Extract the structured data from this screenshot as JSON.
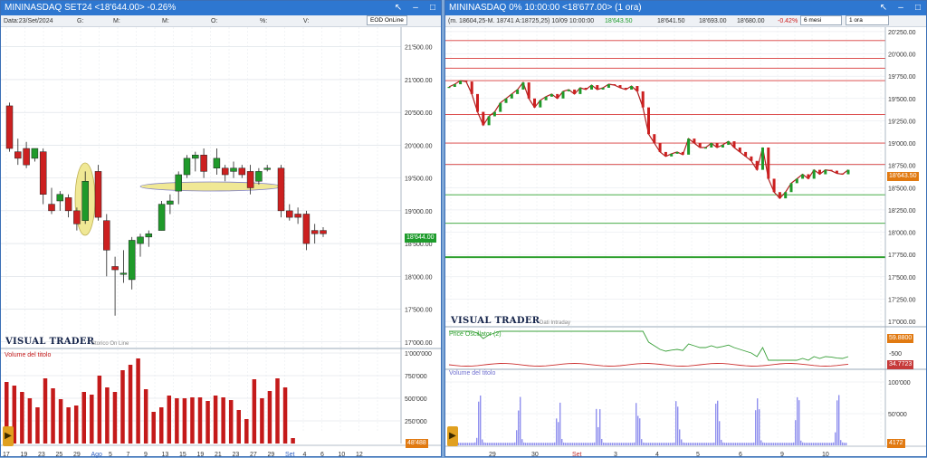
{
  "left": {
    "title": "MININASDAQ SET24 <18'644.00> -0.26%",
    "info": {
      "date": "Data:23/Set/2024",
      "g": "G:",
      "m": "M:",
      "o": "O:",
      "pct": "%:",
      "v": "V:"
    },
    "source_chip": "EOD OnLine",
    "price_tag": "18'644.00",
    "logo": "VISUAL TRADER",
    "logo_sub": "Storico On Line",
    "volume_label": "Volume del titolo",
    "volume_tag": "48'488",
    "y_labels": [
      "21'500.00",
      "21'000.00",
      "20'500.00",
      "20'000.00",
      "19'500.00",
      "19'000.00",
      "18'500.00",
      "18'000.00",
      "17'500.00",
      "17'000.00"
    ],
    "vol_labels": [
      "1'000'000",
      "750'000",
      "500'000",
      "250'000"
    ],
    "x_labels": [
      "17",
      "19",
      "23",
      "25",
      "29",
      "Ago",
      "5",
      "7",
      "9",
      "13",
      "15",
      "19",
      "21",
      "23",
      "27",
      "29",
      "Set",
      "4",
      "6",
      "10",
      "12"
    ],
    "colors": {
      "up": "#1f9a2a",
      "down": "#cc2020",
      "volume": "#c41a1a",
      "highlight": "#efe68a"
    },
    "candles": [
      {
        "o": 20600,
        "h": 20650,
        "l": 19900,
        "c": 19950
      },
      {
        "o": 19900,
        "h": 20100,
        "l": 19700,
        "c": 19800
      },
      {
        "o": 19950,
        "h": 20050,
        "l": 19650,
        "c": 19700
      },
      {
        "o": 19800,
        "h": 19950,
        "l": 19750,
        "c": 19950
      },
      {
        "o": 19900,
        "h": 19950,
        "l": 19100,
        "c": 19250
      },
      {
        "o": 19100,
        "h": 19350,
        "l": 18950,
        "c": 19000
      },
      {
        "o": 19150,
        "h": 19300,
        "l": 19000,
        "c": 19250
      },
      {
        "o": 19200,
        "h": 19250,
        "l": 18900,
        "c": 19000
      },
      {
        "o": 19000,
        "h": 19050,
        "l": 18700,
        "c": 18800
      },
      {
        "o": 18850,
        "h": 19600,
        "l": 18800,
        "c": 19450
      },
      {
        "o": 19600,
        "h": 19700,
        "l": 18850,
        "c": 18900
      },
      {
        "o": 18850,
        "h": 18950,
        "l": 18000,
        "c": 18400
      },
      {
        "o": 18150,
        "h": 18300,
        "l": 17400,
        "c": 18100
      },
      {
        "o": 18050,
        "h": 18400,
        "l": 17900,
        "c": 18050
      },
      {
        "o": 17950,
        "h": 18600,
        "l": 17800,
        "c": 18550
      },
      {
        "o": 18500,
        "h": 18650,
        "l": 18300,
        "c": 18600
      },
      {
        "o": 18600,
        "h": 18700,
        "l": 18450,
        "c": 18650
      },
      {
        "o": 18700,
        "h": 19150,
        "l": 18700,
        "c": 19100
      },
      {
        "o": 19100,
        "h": 19250,
        "l": 18950,
        "c": 19150
      },
      {
        "o": 19300,
        "h": 19600,
        "l": 19100,
        "c": 19550
      },
      {
        "o": 19550,
        "h": 19850,
        "l": 19500,
        "c": 19800
      },
      {
        "o": 19800,
        "h": 19900,
        "l": 19600,
        "c": 19850
      },
      {
        "o": 19850,
        "h": 19950,
        "l": 19500,
        "c": 19600
      },
      {
        "o": 19650,
        "h": 19950,
        "l": 19550,
        "c": 19800
      },
      {
        "o": 19650,
        "h": 19700,
        "l": 19450,
        "c": 19550
      },
      {
        "o": 19600,
        "h": 19750,
        "l": 19500,
        "c": 19650
      },
      {
        "o": 19650,
        "h": 19700,
        "l": 19500,
        "c": 19550
      },
      {
        "o": 19600,
        "h": 19700,
        "l": 19250,
        "c": 19350
      },
      {
        "o": 19450,
        "h": 19650,
        "l": 19400,
        "c": 19600
      },
      {
        "o": 19650,
        "h": 19700,
        "l": 19600,
        "c": 19650
      },
      {
        "o": 19650,
        "h": 19700,
        "l": 18900,
        "c": 19000
      },
      {
        "o": 19000,
        "h": 19100,
        "l": 18850,
        "c": 18900
      },
      {
        "o": 18950,
        "h": 19050,
        "l": 18800,
        "c": 18900
      },
      {
        "o": 18950,
        "h": 19000,
        "l": 18400,
        "c": 18500
      },
      {
        "o": 18700,
        "h": 18800,
        "l": 18500,
        "c": 18650
      },
      {
        "o": 18700,
        "h": 18750,
        "l": 18600,
        "c": 18650
      }
    ],
    "volumes": [
      680000,
      640000,
      570000,
      500000,
      400000,
      720000,
      610000,
      490000,
      400000,
      420000,
      570000,
      540000,
      750000,
      620000,
      570000,
      810000,
      870000,
      940000,
      600000,
      350000,
      400000,
      530000,
      500000,
      500000,
      510000,
      510000,
      470000,
      530000,
      510000,
      480000,
      370000,
      270000,
      710000,
      500000,
      580000,
      720000,
      620000,
      60000
    ]
  },
  "right": {
    "title": "MININASDAQ 0% 10:00:00  <18'677.00> (1 ora)",
    "info": {
      "ohlc": "(m. 18604,25-M. 18741 A:18725,25) 10/09 10:00:00",
      "price1": "18'643.50",
      "price2": "18'641.50",
      "high": "18'693.00",
      "low": "18'680.00",
      "pct": "-0.42%"
    },
    "range_chip": "6 mesi",
    "interval_chip": "1 ora",
    "price_tag": "18'643.50",
    "logo": "VISUAL TRADER",
    "logo_sub": "Dati Intraday",
    "osc_label": "Price Oscillator (2)",
    "osc_tag1": "59.8800",
    "osc_tag2": "34.7723",
    "osc_y": "-500",
    "volume_label": "Volume del titolo",
    "volume_tag": "4172",
    "y_labels": [
      "20'250.00",
      "20'000.00",
      "19'750.00",
      "19'500.00",
      "19'250.00",
      "19'000.00",
      "18'750.00",
      "18'500.00",
      "18'250.00",
      "18'000.00",
      "17'750.00",
      "17'500.00",
      "17'250.00",
      "17'000.00"
    ],
    "vol_labels": [
      "100'000",
      "50'000"
    ],
    "x_labels": [
      "29",
      "30",
      "Set",
      "3",
      "4",
      "5",
      "6",
      "9",
      "10"
    ],
    "colors": {
      "red_line": "#d83a3a",
      "green_line": "#2fa02f",
      "volume": "#9090ee",
      "osc_green": "#3aa03a",
      "osc_red": "#cc3030"
    },
    "support_levels_red": [
      20150,
      19950,
      19840,
      19700,
      19320,
      19000,
      18760
    ],
    "support_levels_green": [
      18420,
      18100,
      17720
    ],
    "close_series": [
      19630,
      19660,
      19700,
      19690,
      19550,
      19350,
      19200,
      19300,
      19350,
      19450,
      19500,
      19550,
      19600,
      19680,
      19500,
      19400,
      19480,
      19520,
      19550,
      19500,
      19580,
      19600,
      19550,
      19620,
      19600,
      19650,
      19600,
      19620,
      19660,
      19650,
      19620,
      19600,
      19640,
      19580,
      19400,
      19100,
      19000,
      18900,
      18850,
      18880,
      18900,
      18870,
      19050,
      19000,
      18950,
      18950,
      19000,
      18950,
      18980,
      19020,
      18950,
      18900,
      18850,
      18800,
      18700,
      18950,
      18600,
      18450,
      18380,
      18450,
      18550,
      18600,
      18650,
      18600,
      18700,
      18650,
      18700,
      18690,
      18660,
      18650,
      18700
    ]
  }
}
